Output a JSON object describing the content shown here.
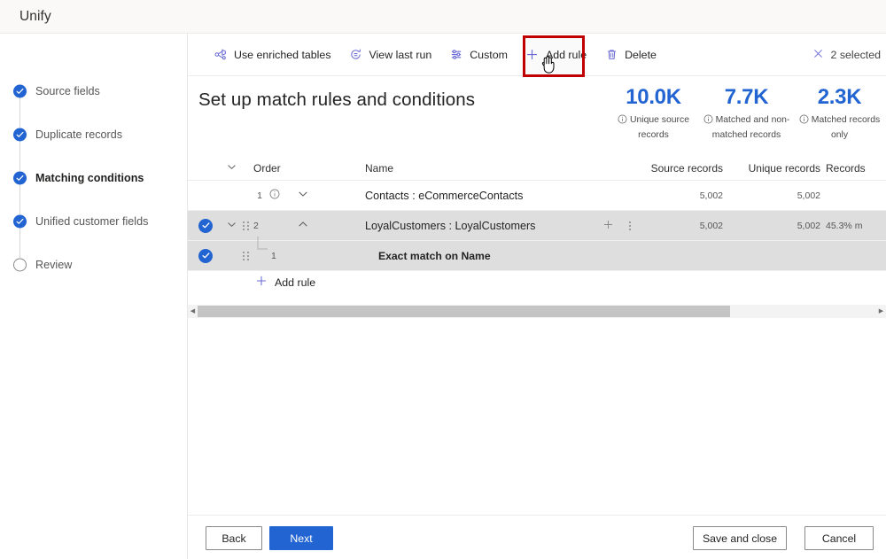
{
  "topbar": {
    "title": "Unify"
  },
  "sidebar": {
    "items": [
      {
        "label": "Source fields",
        "state": "done"
      },
      {
        "label": "Duplicate records",
        "state": "done"
      },
      {
        "label": "Matching conditions",
        "state": "current"
      },
      {
        "label": "Unified customer fields",
        "state": "done"
      },
      {
        "label": "Review",
        "state": "pending"
      }
    ]
  },
  "toolbar": {
    "items": [
      {
        "label": "Use enriched tables",
        "icon": "enriched-tables-icon"
      },
      {
        "label": "View last run",
        "icon": "history-clock-icon"
      },
      {
        "label": "Custom",
        "icon": "sliders-icon"
      },
      {
        "label": "Add rule",
        "icon": "plus-icon"
      },
      {
        "label": "Delete",
        "icon": "trash-icon"
      }
    ],
    "selection_label": "2 selected",
    "selection_icon": "close-icon",
    "highlight_target": "Delete",
    "highlight_color": "#c00000"
  },
  "main": {
    "page_title": "Set up match rules and conditions",
    "kpis": [
      {
        "value": "10.0K",
        "caption": "Unique source records"
      },
      {
        "value": "7.7K",
        "caption": "Matched and non-matched records"
      },
      {
        "value": "2.3K",
        "caption": "Matched records only"
      }
    ],
    "kpi_color": "#2264d1",
    "table": {
      "columns": [
        "Order",
        "Name",
        "Source records",
        "Unique records",
        "Records"
      ],
      "rows": [
        {
          "selected": false,
          "order": "1",
          "name": "Contacts : eCommerceContacts",
          "source_records": "5,002",
          "unique_records": "5,002",
          "records_pct": "",
          "expanded": false
        },
        {
          "selected": true,
          "order": "2",
          "name": "LoyalCustomers : LoyalCustomers",
          "source_records": "5,002",
          "unique_records": "5,002",
          "records_pct": "45.3% m",
          "expanded": true
        }
      ],
      "child_row": {
        "selected": true,
        "order": "1",
        "name": "Exact match on Name"
      },
      "add_rule_label": "Add rule"
    }
  },
  "footer": {
    "back": "Back",
    "next": "Next",
    "save_and_close": "Save and close",
    "cancel": "Cancel"
  }
}
